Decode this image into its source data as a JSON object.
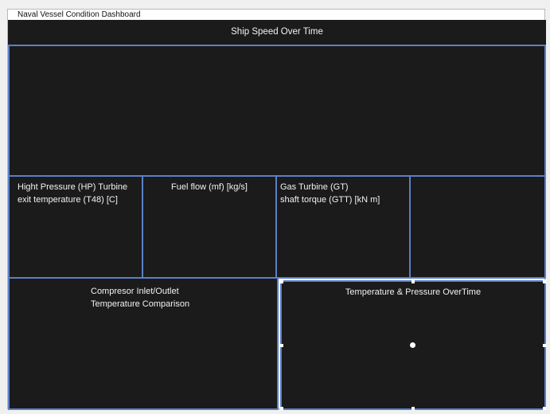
{
  "window": {
    "title": "Naval Vessel Condition Dashboard"
  },
  "panels": {
    "ship_speed": {
      "title": "Ship Speed Over Time"
    },
    "hp_turbine": {
      "title_line1": "Hight Pressure (HP) Turbine",
      "title_line2": "exit temperature (T48) [C]"
    },
    "fuel_flow": {
      "title": "Fuel flow (mf) [kg/s]"
    },
    "gas_turbine": {
      "title_line1": "Gas Turbine (GT)",
      "title_line2": "shaft torque (GTT) [kN m]"
    },
    "compressor": {
      "title_line1": "Compresor Inlet/Outlet",
      "title_line2": "Temperature Comparison"
    },
    "temp_pressure": {
      "title": "Temperature & Pressure OverTime"
    }
  },
  "colors": {
    "panel_bg": "#1b1b1b",
    "border": "#5b80c8",
    "text": "#f2f2f2"
  }
}
